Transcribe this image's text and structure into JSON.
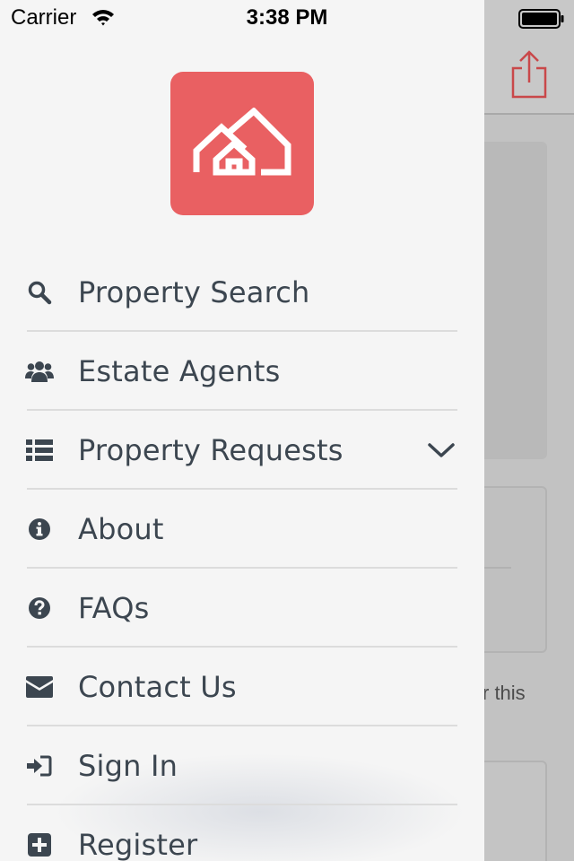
{
  "status_bar": {
    "carrier": "Carrier",
    "time": "3:38 PM"
  },
  "background": {
    "share_icon": "share-icon",
    "partial_text": "r this"
  },
  "drawer": {
    "logo_icon": "house-logo-icon",
    "logo_color": "#e96062",
    "menu": [
      {
        "label": "Property Search",
        "icon": "search-icon"
      },
      {
        "label": "Estate Agents",
        "icon": "users-icon"
      },
      {
        "label": "Property Requests",
        "icon": "list-icon",
        "expandable": true
      },
      {
        "label": "About",
        "icon": "info-icon"
      },
      {
        "label": "FAQs",
        "icon": "question-icon"
      },
      {
        "label": "Contact Us",
        "icon": "envelope-icon"
      },
      {
        "label": "Sign In",
        "icon": "sign-in-icon"
      },
      {
        "label": "Register",
        "icon": "plus-square-icon"
      }
    ]
  },
  "colors": {
    "accent": "#e96062",
    "text": "#3c4650",
    "drawer_bg": "#f5f5f5",
    "divider": "#dcdcdc"
  }
}
